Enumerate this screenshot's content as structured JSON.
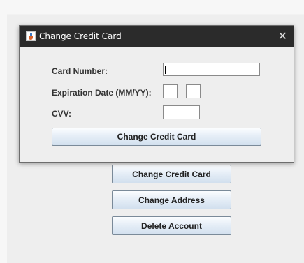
{
  "dialog": {
    "title": "Change Credit Card",
    "close_glyph": "✕",
    "card_number_label": "Card Number:",
    "card_number_value": "",
    "expiration_label": "Expiration Date (MM/YY):",
    "expiration_month_value": "",
    "expiration_year_value": "",
    "cvv_label": "CVV:",
    "cvv_value": "",
    "submit_label": "Change Credit Card",
    "app_icon": "java-cup-icon"
  },
  "main": {
    "buttons": [
      {
        "label": "Change Credit Card"
      },
      {
        "label": "Change Address"
      },
      {
        "label": "Delete Account"
      }
    ]
  },
  "colors": {
    "titlebar": "#2b2b2b",
    "window_bg": "#eeeeee",
    "button_border": "#7a8a99"
  }
}
